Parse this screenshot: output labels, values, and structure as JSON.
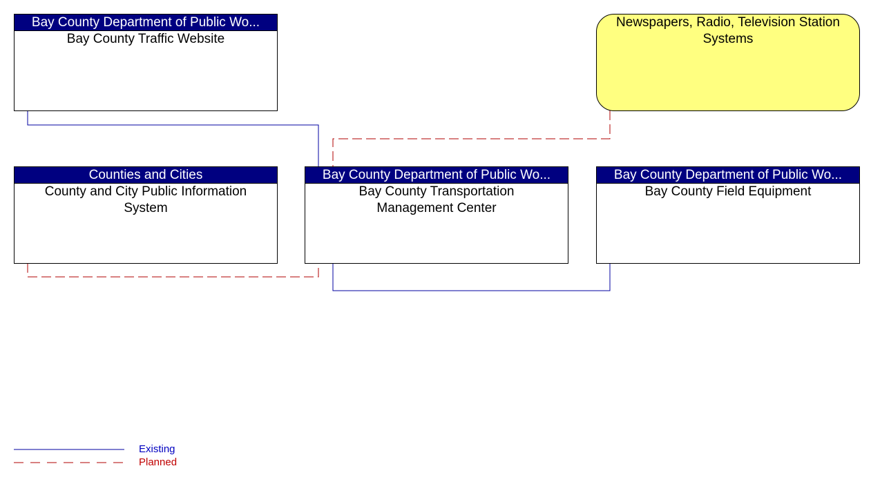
{
  "colors": {
    "existing": "#0000a0",
    "planned": "#b00000",
    "header_bg": "#000080",
    "external_bg": "#ffff80"
  },
  "nodes": [
    {
      "id": "traffic-website",
      "header": "Bay County Department of Public Wo...",
      "title": "Bay County Traffic Website"
    },
    {
      "id": "media-systems",
      "header": "",
      "title": "Newspapers, Radio, Television Station Systems"
    },
    {
      "id": "public-info",
      "header": "Counties and Cities",
      "title": "County and City Public Information System"
    },
    {
      "id": "tmc",
      "header": "Bay County Department of Public Wo...",
      "title": "Bay County Transportation Management Center"
    },
    {
      "id": "field-equipment",
      "header": "Bay County Department of Public Wo...",
      "title": "Bay County Field Equipment"
    }
  ],
  "links": [
    {
      "from": "traffic-website",
      "to": "tmc",
      "status": "existing"
    },
    {
      "from": "media-systems",
      "to": "tmc",
      "status": "planned"
    },
    {
      "from": "public-info",
      "to": "tmc",
      "status": "planned"
    },
    {
      "from": "tmc",
      "to": "field-equipment",
      "status": "existing"
    }
  ],
  "legend": {
    "existing": "Existing",
    "planned": "Planned"
  }
}
